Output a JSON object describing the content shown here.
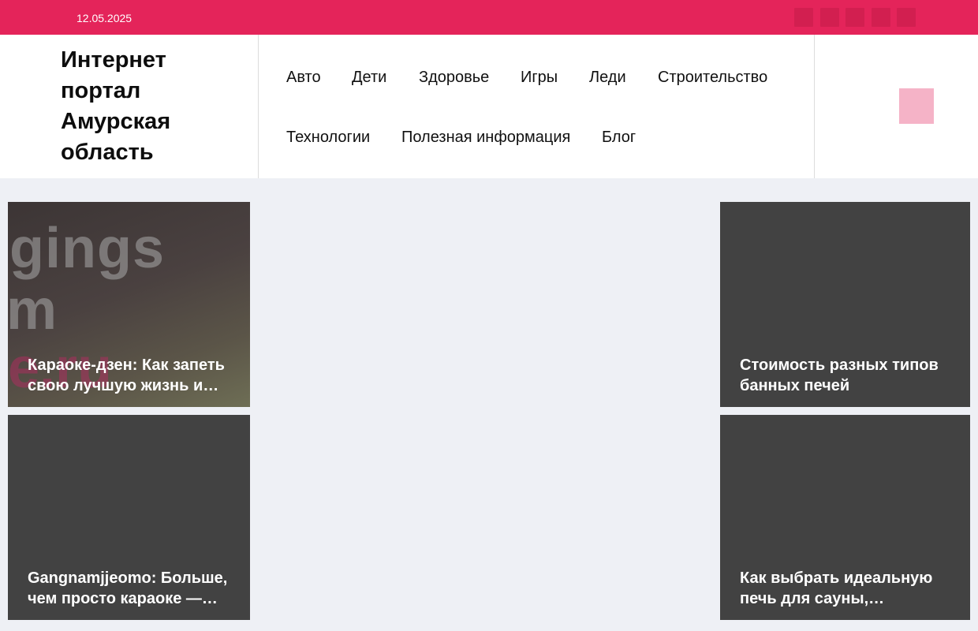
{
  "topbar": {
    "date": "12.05.2025",
    "social_icons": [
      "social-icon-1",
      "social-icon-2",
      "social-icon-3",
      "social-icon-4",
      "social-icon-5"
    ],
    "background": "#e4245a"
  },
  "header": {
    "logo": "Интернет портал Амурская область",
    "nav": [
      "Авто",
      "Дети",
      "Здоровье",
      "Игры",
      "Леди",
      "Строительство",
      "Технологии",
      "Полезная информация",
      "Блог"
    ],
    "accent": "#f5b3c7"
  },
  "cards": [
    {
      "title": " Караоке-дзен: Как запеть свою лучшую жизнь и…"
    },
    {
      "title": "Стоимость разных типов банных печей"
    },
    {
      "title": "Gangnamjjeomo: Больше, чем просто караоке —…"
    },
    {
      "title": "Как выбрать идеальную печь для сауны,…"
    }
  ]
}
